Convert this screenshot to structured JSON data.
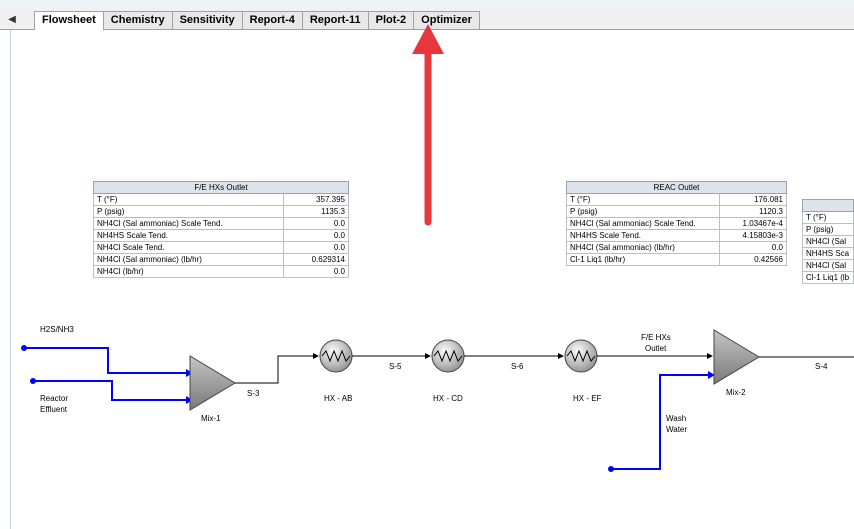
{
  "tabs": [
    {
      "label": "Flowsheet",
      "active": true
    },
    {
      "label": "Chemistry"
    },
    {
      "label": "Sensitivity"
    },
    {
      "label": "Report-4"
    },
    {
      "label": "Report-11"
    },
    {
      "label": "Plot-2"
    },
    {
      "label": "Optimizer"
    }
  ],
  "tab_scroll_glyph": "◀",
  "colors": {
    "stream": "#0000ff",
    "arrow": "#e8373b",
    "equipment": "#8a8a8a"
  },
  "tables": {
    "fe": {
      "title": "F/E HXs Outlet",
      "rows": [
        {
          "label": "T (°F)",
          "value": "357.395"
        },
        {
          "label": "P (psig)",
          "value": "1135.3"
        },
        {
          "label": "NH4Cl (Sal ammoniac) Scale Tend.",
          "value": "0.0"
        },
        {
          "label": "NH4HS Scale Tend.",
          "value": "0.0"
        },
        {
          "label": "NH4Cl Scale Tend.",
          "value": "0.0"
        },
        {
          "label": "NH4Cl (Sal ammoniac) (lb/hr)",
          "value": "0.629314"
        },
        {
          "label": "NH4Cl (lb/hr)",
          "value": "0.0"
        }
      ]
    },
    "reac": {
      "title": "REAC Outlet",
      "rows": [
        {
          "label": "T (°F)",
          "value": "176.081"
        },
        {
          "label": "P (psig)",
          "value": "1120.3"
        },
        {
          "label": "NH4Cl (Sal ammoniac) Scale Tend.",
          "value": "1.03467e-4"
        },
        {
          "label": "NH4HS Scale Tend.",
          "value": "4.15803e-3"
        },
        {
          "label": "NH4Cl (Sal ammoniac) (lb/hr)",
          "value": "0.0"
        },
        {
          "label": "Cl-1 Liq1 (lb/hr)",
          "value": "0.42566"
        }
      ]
    },
    "partial": {
      "title": "",
      "rows": [
        {
          "label": "T (°F)"
        },
        {
          "label": "P (psig)"
        },
        {
          "label": "NH4Cl (Sal"
        },
        {
          "label": "NH4HS Sca"
        },
        {
          "label": "NH4Cl (Sal"
        },
        {
          "label": "Cl-1 Liq1 (lb"
        }
      ]
    }
  },
  "flowsheet": {
    "feed1": "H2S/NH3",
    "feed2_line1": "Reactor",
    "feed2_line2": "Effluent",
    "mix1": "Mix-1",
    "s3": "S-3",
    "hx_ab": "HX - AB",
    "s5": "S-5",
    "hx_cd": "HX - CD",
    "s6": "S-6",
    "hx_ef": "HX - EF",
    "fe_line1": "F/E HXs",
    "fe_line2": "Outlet",
    "mix2": "Mix-2",
    "s4": "S-4",
    "wash_line1": "Wash",
    "wash_line2": "Water"
  }
}
